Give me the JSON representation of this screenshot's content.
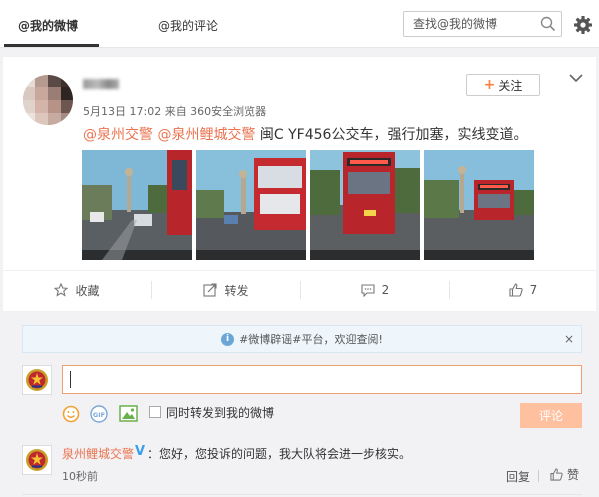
{
  "tabs": [
    {
      "label": "@我的微博",
      "active": true
    },
    {
      "label": "@我的评论",
      "active": false
    }
  ],
  "search": {
    "placeholder": "查找@我的微博"
  },
  "post": {
    "meta": "5月13日 17:02 来自 360安全浏览器",
    "follow_label": "关注",
    "mention_1": "@泉州交警",
    "mention_2": "@泉州鲤城交警",
    "body_text": " 闽C YF456公交车，强行加塞，实线变道。"
  },
  "actions": {
    "favorite": "收藏",
    "repost": "转发",
    "comment_count": "2",
    "like_count": "7"
  },
  "comment_box": {
    "notice": "#微博辟谣#平台，欢迎查阅!",
    "notice_close": "×",
    "repost_label": "同时转发到我的微博",
    "submit_label": "评论"
  },
  "reply": {
    "author": "泉州鲤城交警",
    "verified_mark": "V",
    "text": "：您好，您投诉的问题，我大队将会进一步核实。",
    "time": "10秒前",
    "reply_label": "回复",
    "like_label": "赞"
  },
  "colors": {
    "accent": "#eb7350",
    "button_disabled": "#ffc09f",
    "link_blue": "#3a9ee8"
  }
}
